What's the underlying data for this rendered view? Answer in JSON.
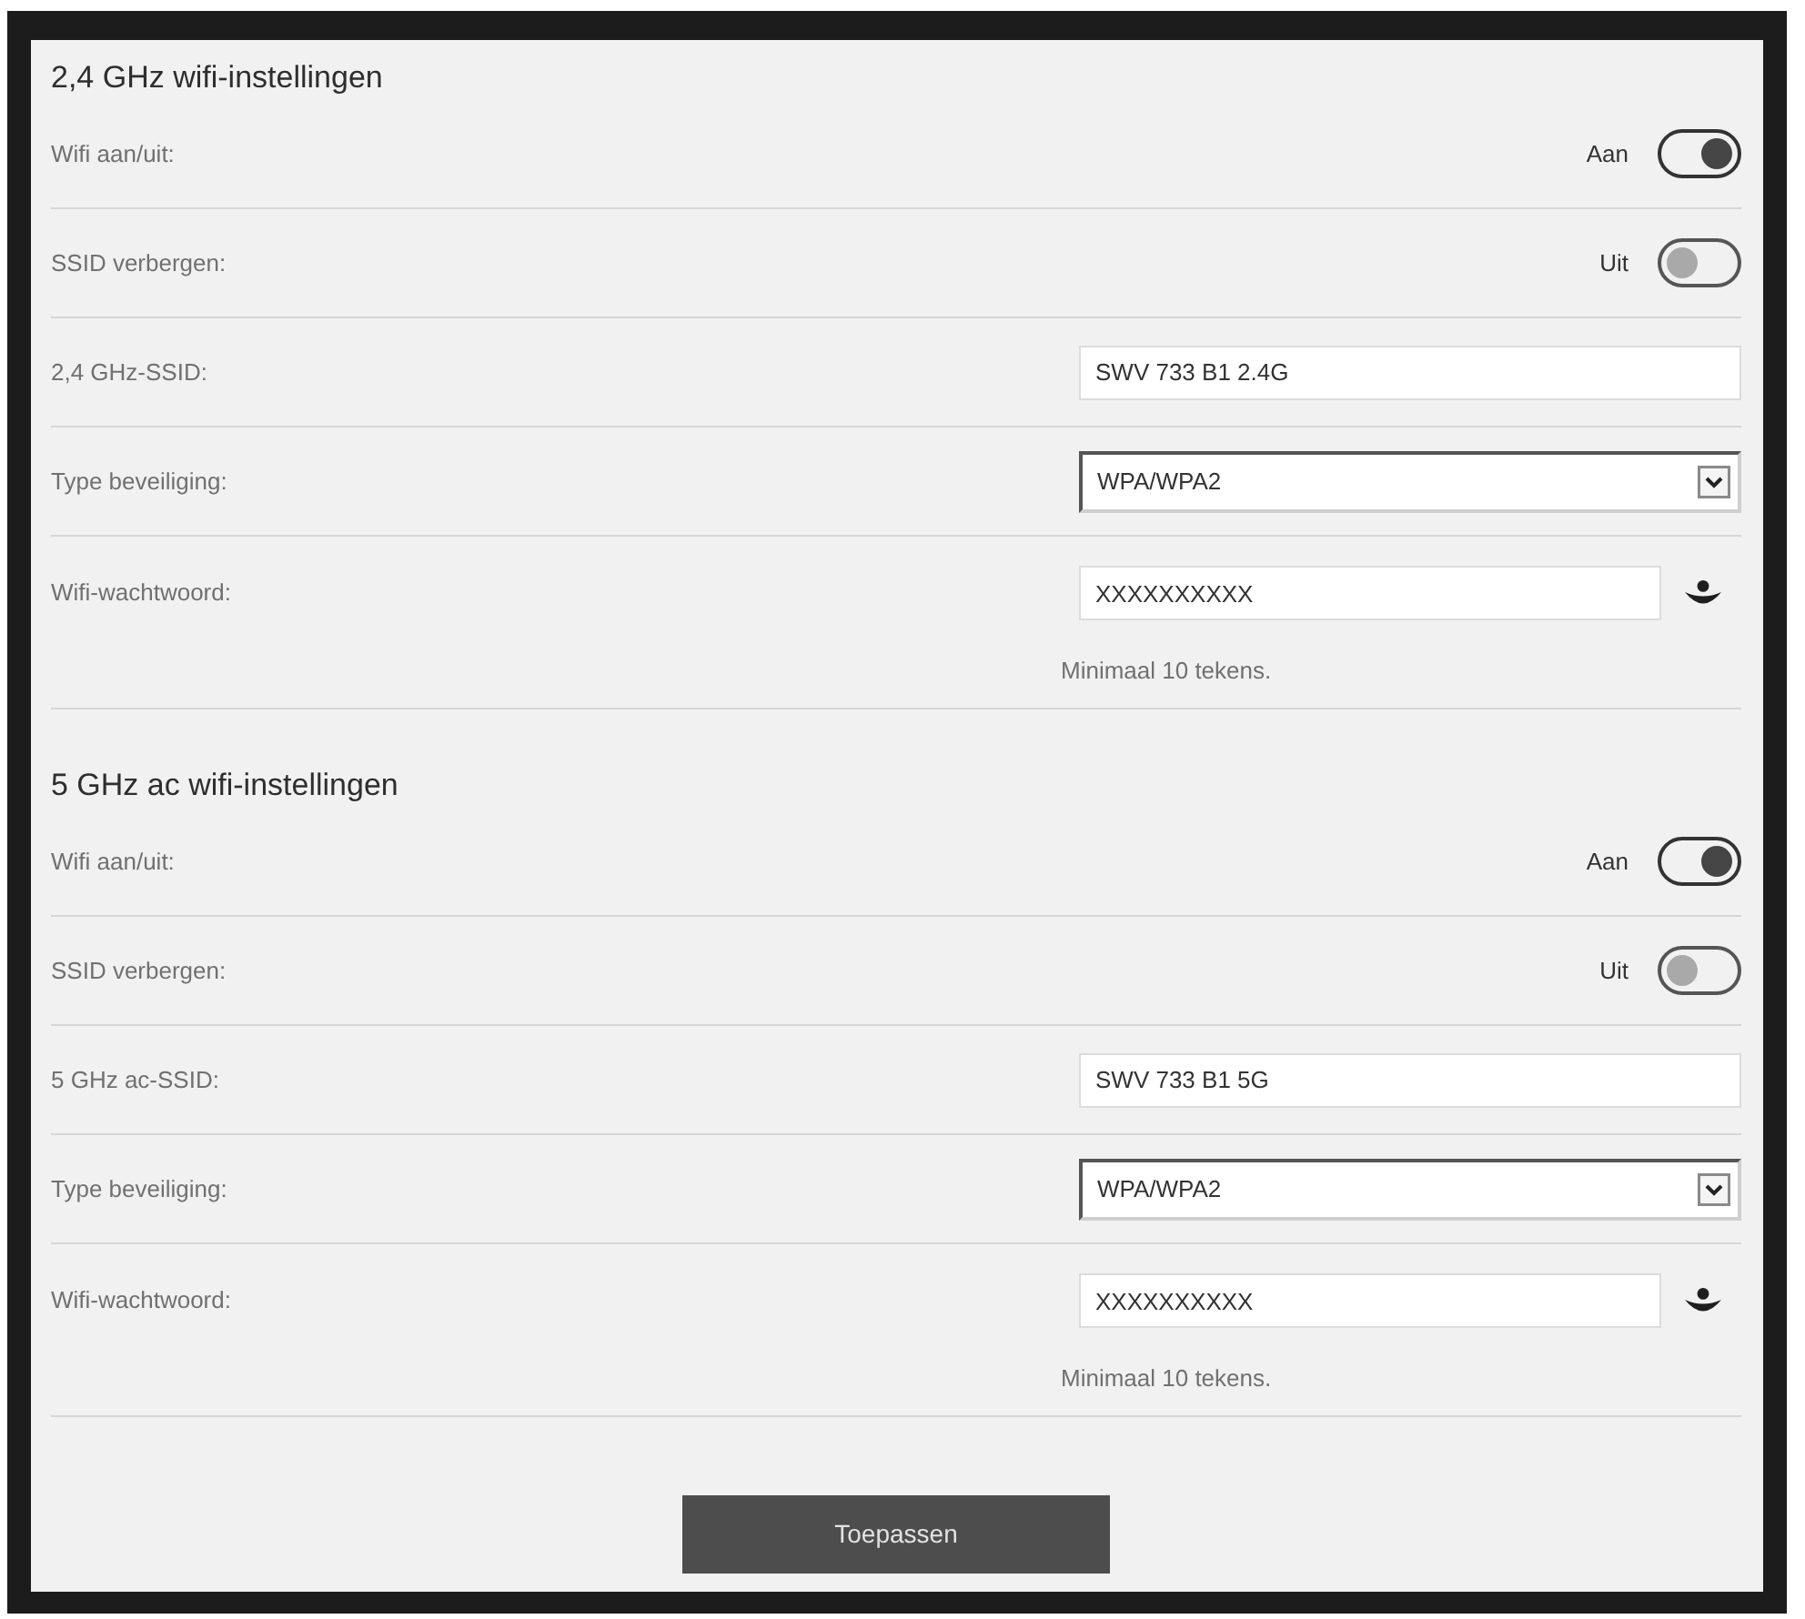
{
  "sections": [
    {
      "title": "2,4 GHz wifi-instellingen",
      "rows": [
        {
          "kind": "toggle",
          "label": "Wifi aan/uit:",
          "state_label": "Aan",
          "on": true
        },
        {
          "kind": "toggle",
          "label": "SSID verbergen:",
          "state_label": "Uit",
          "on": false
        },
        {
          "kind": "text",
          "label": "2,4 GHz-SSID:",
          "value": "SWV 733 B1 2.4G"
        },
        {
          "kind": "select",
          "label": "Type beveiliging:",
          "value": "WPA/WPA2"
        },
        {
          "kind": "password",
          "label": "Wifi-wachtwoord:",
          "value": "XXXXXXXXXX",
          "hint": "Minimaal 10 tekens."
        }
      ]
    },
    {
      "title": "5 GHz ac wifi-instellingen",
      "rows": [
        {
          "kind": "toggle",
          "label": "Wifi aan/uit:",
          "state_label": "Aan",
          "on": true
        },
        {
          "kind": "toggle",
          "label": "SSID verbergen:",
          "state_label": "Uit",
          "on": false
        },
        {
          "kind": "text",
          "label": "5 GHz ac-SSID:",
          "value": "SWV 733 B1 5G"
        },
        {
          "kind": "select",
          "label": "Type beveiliging:",
          "value": "WPA/WPA2"
        },
        {
          "kind": "password",
          "label": "Wifi-wachtwoord:",
          "value": "XXXXXXXXXX",
          "hint": "Minimaal 10 tekens."
        }
      ]
    }
  ],
  "apply_button": "Toepassen"
}
